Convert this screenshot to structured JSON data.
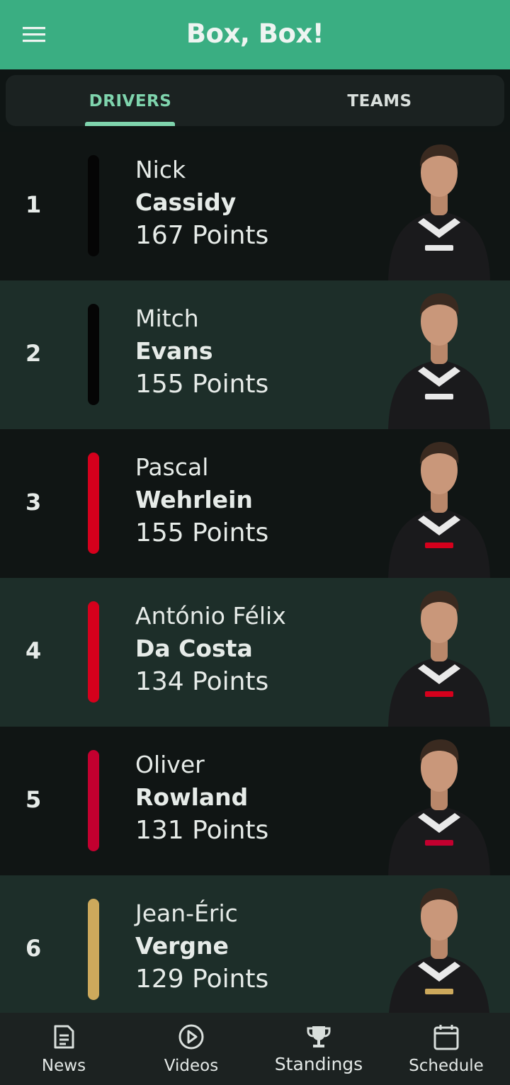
{
  "app": {
    "title": "Box, Box!"
  },
  "tabs": [
    {
      "label": "DRIVERS",
      "selected": true
    },
    {
      "label": "TEAMS",
      "selected": false
    }
  ],
  "drivers": [
    {
      "position": "1",
      "first_name": "Nick",
      "last_name": "Cassidy",
      "points": "167 Points",
      "team_color": "#050505"
    },
    {
      "position": "2",
      "first_name": "Mitch",
      "last_name": "Evans",
      "points": "155 Points",
      "team_color": "#050505"
    },
    {
      "position": "3",
      "first_name": "Pascal",
      "last_name": "Wehrlein",
      "points": "155 Points",
      "team_color": "#d5001c"
    },
    {
      "position": "4",
      "first_name": "António Félix",
      "last_name": "Da Costa",
      "points": "134 Points",
      "team_color": "#d5001c"
    },
    {
      "position": "5",
      "first_name": "Oliver",
      "last_name": "Rowland",
      "points": "131 Points",
      "team_color": "#c3002f"
    },
    {
      "position": "6",
      "first_name": "Jean-Éric",
      "last_name": "Vergne",
      "points": "129 Points",
      "team_color": "#cda95c"
    }
  ],
  "bottom_nav": [
    {
      "label": "News",
      "icon": "news-icon",
      "active": false
    },
    {
      "label": "Videos",
      "icon": "play-circle-icon",
      "active": false
    },
    {
      "label": "Standings",
      "icon": "trophy-icon",
      "active": true
    },
    {
      "label": "Schedule",
      "icon": "calendar-icon",
      "active": false
    }
  ],
  "colors": {
    "appbar": "#3aae82",
    "accent": "#7fd4ad",
    "row_dark": "#101514",
    "row_light": "#1d2e29",
    "nav_bg": "#1c2221"
  }
}
